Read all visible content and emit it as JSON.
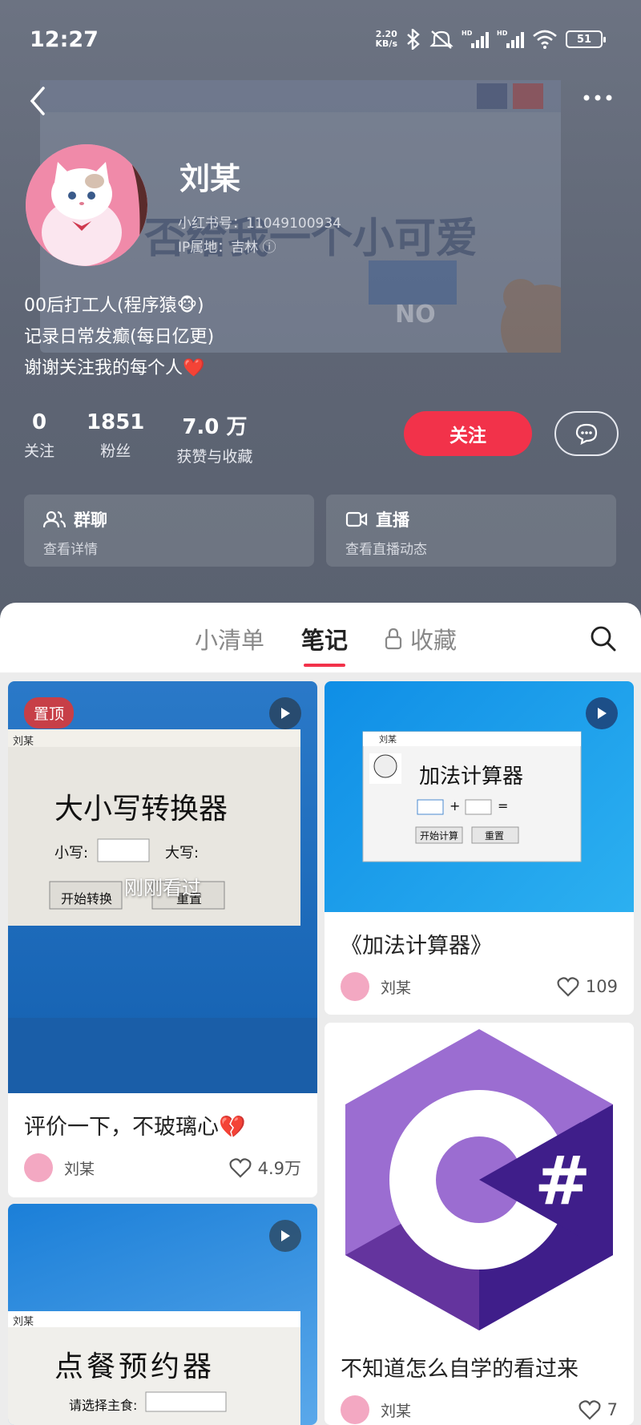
{
  "status": {
    "time": "12:27",
    "speed_top": "2.20",
    "speed_bottom": "KB/s",
    "battery": "51"
  },
  "profile": {
    "name": "刘某",
    "id_line": "小红书号：11049100934",
    "ip_line": "IP属地：吉林 ⓘ",
    "bio": [
      "00后打工人(程序猿🐵)",
      "记录日常发癫(每日亿更)",
      "谢谢关注我的每个人❤️"
    ],
    "stats": [
      {
        "num": "0",
        "label": "关注"
      },
      {
        "num": "1851",
        "label": "粉丝"
      },
      {
        "num": "7.0 万",
        "label": "获赞与收藏"
      }
    ],
    "follow_label": "关注",
    "group": {
      "title": "群聊",
      "sub": "查看详情"
    },
    "live": {
      "title": "直播",
      "sub": "查看直播动态"
    },
    "banner_text": "否给我一个小可爱",
    "banner_no": "NO"
  },
  "tabs": {
    "list": "小清单",
    "notes": "笔记",
    "fav": "收藏"
  },
  "posts": [
    {
      "pinned": "置顶",
      "title": "评价一下，不玻璃心💔",
      "author": "刘某",
      "likes": "4.9万",
      "overlay": "刚刚看过",
      "app_title": "刘某",
      "app_heading": "大小写转换器",
      "label_lower": "小写:",
      "label_upper": "大写:",
      "btn_start": "开始转换",
      "btn_reset": "重置"
    },
    {
      "title": "《加法计算器》",
      "author": "刘某",
      "likes": "109",
      "app_title": "刘某",
      "app_heading": "加法计算器",
      "btn_start": "开始计算",
      "btn_reset": "重置",
      "plus": "+",
      "equals": "="
    },
    {
      "title": "不知道怎么自学的看过来",
      "author": "刘某",
      "likes": "7",
      "logo_text": "#"
    },
    {
      "app_title": "刘某",
      "app_heading": "点餐预约器",
      "label_food": "请选择主食:"
    }
  ]
}
